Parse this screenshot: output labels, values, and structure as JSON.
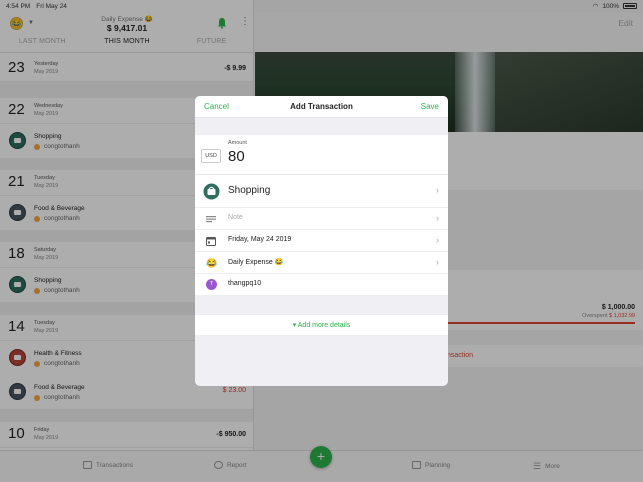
{
  "status_bar": {
    "time": "4:54 PM",
    "date": "Fri May 24",
    "battery": "100%"
  },
  "left": {
    "wallet_name": "Daily Expense 😂",
    "wallet_balance": "$ 9,417.01",
    "tabs": [
      "LAST MONTH",
      "THIS MONTH",
      "FUTURE"
    ],
    "days": [
      {
        "num": "23",
        "name": "Yesterday",
        "month": "May 2019",
        "total": "-$ 9.99",
        "txs": []
      },
      {
        "num": "22",
        "name": "Wednesday",
        "month": "May 2019",
        "total": "",
        "txs": [
          {
            "cat": "Shopping",
            "user": "congtothanh",
            "amount": "",
            "icon": "shop"
          }
        ]
      },
      {
        "num": "21",
        "name": "Tuesday",
        "month": "May 2019",
        "total": "",
        "txs": [
          {
            "cat": "Food & Beverage",
            "user": "congtothanh",
            "amount": "",
            "icon": "food"
          }
        ]
      },
      {
        "num": "18",
        "name": "Saturday",
        "month": "May 2019",
        "total": "",
        "txs": [
          {
            "cat": "Shopping",
            "user": "congtothanh",
            "amount": "",
            "icon": "shop"
          }
        ]
      },
      {
        "num": "14",
        "name": "Tuesday",
        "month": "May 2019",
        "total": "",
        "txs": [
          {
            "cat": "Health & Fitness",
            "user": "congtothanh",
            "amount": "",
            "icon": "health"
          },
          {
            "cat": "Food & Beverage",
            "user": "congtothanh",
            "amount": "$ 23.00",
            "icon": "food"
          }
        ]
      },
      {
        "num": "10",
        "name": "Friday",
        "month": "May 2019",
        "total": "-$ 950.00",
        "txs": []
      }
    ]
  },
  "right": {
    "edit_label": "Edit",
    "budget_amount": "$ 1,000.00",
    "overspent_label": "Overspent",
    "overspent_value": "$ 1,032.99",
    "delete_label": "nsaction"
  },
  "tabbar": {
    "transactions": "Transactions",
    "report": "Report",
    "planning": "Planning",
    "more": "More",
    "add": "+"
  },
  "modal": {
    "cancel": "Cancel",
    "title": "Add Transaction",
    "save": "Save",
    "currency": "USD",
    "amount_label": "Amount",
    "amount_value": "80",
    "category": "Shopping",
    "note_placeholder": "Note",
    "date": "Friday, May 24 2019",
    "wallet": "Daily Expense 😂",
    "user_initial": "T",
    "user": "thangpq10",
    "more_details": "Add more details"
  },
  "colors": {
    "accent": "#2db34a",
    "negative": "#e0442e",
    "avatar": "#9b59d0"
  }
}
